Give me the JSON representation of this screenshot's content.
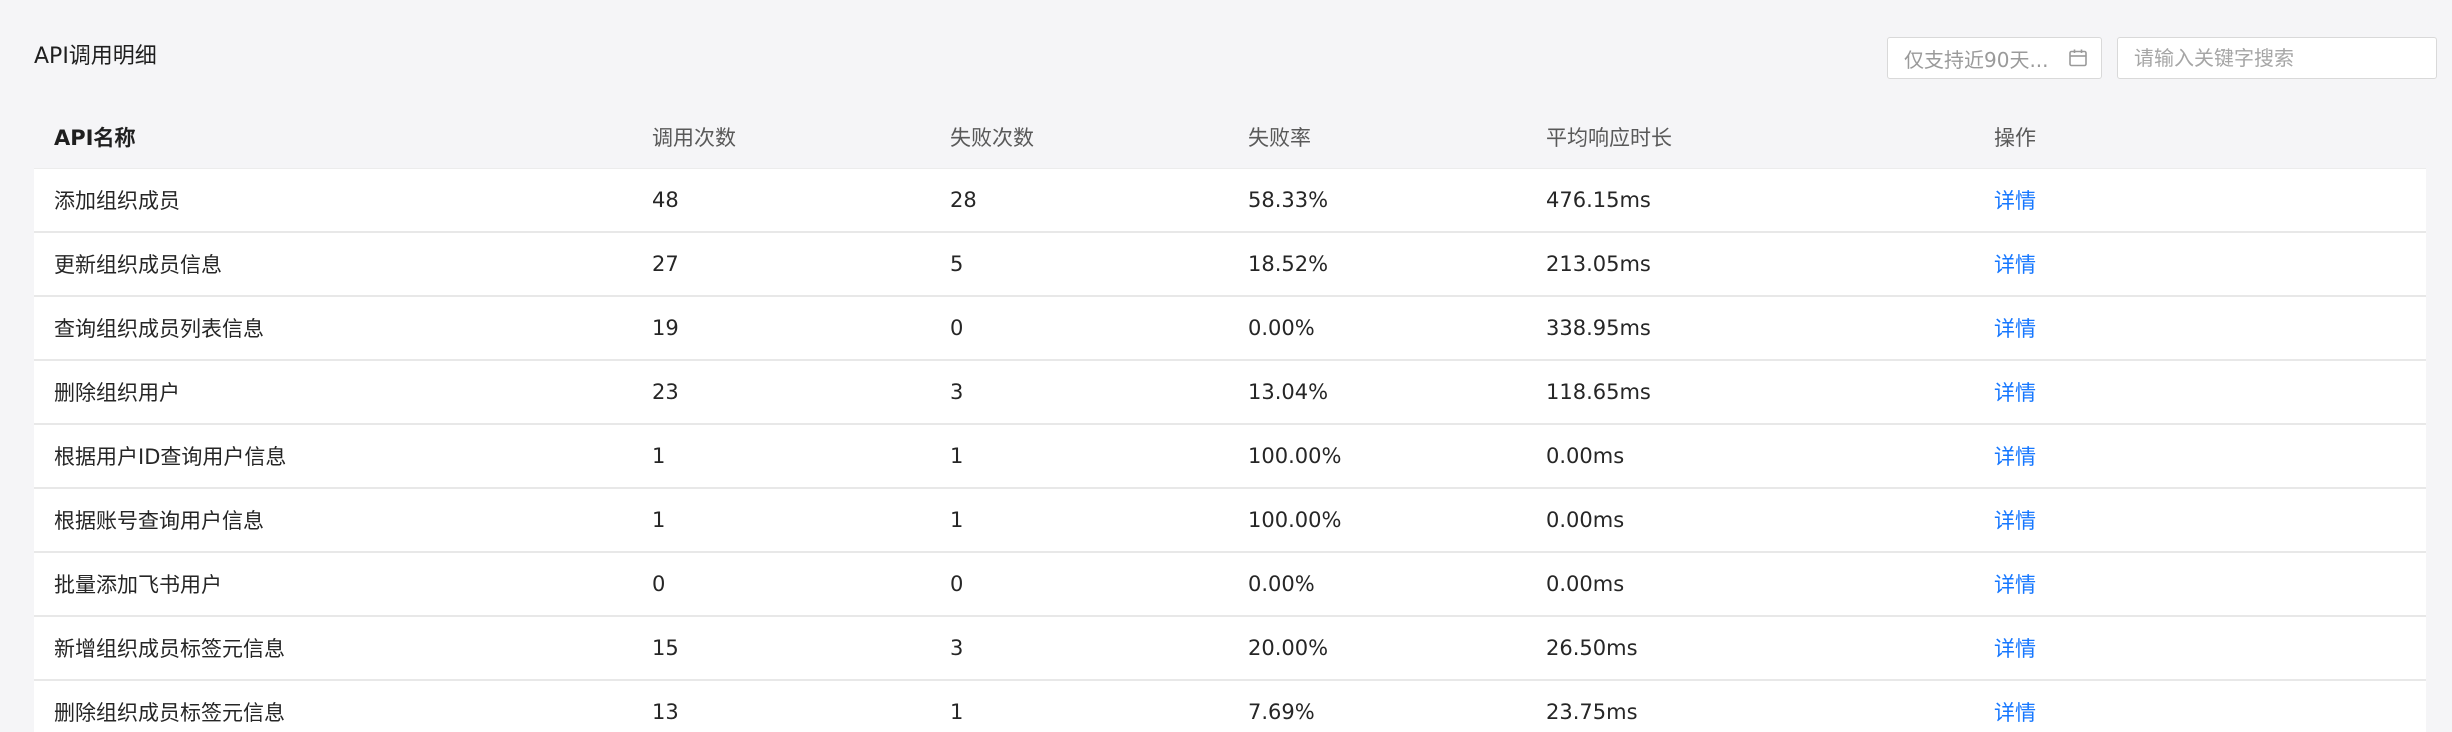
{
  "header": {
    "title": "API调用明细",
    "date_filter_label": "仅支持近90天...",
    "search_placeholder": "请输入关键字搜索"
  },
  "table": {
    "columns": [
      "API名称",
      "调用次数",
      "失败次数",
      "失败率",
      "平均响应时长",
      "操作"
    ],
    "rows": [
      {
        "name": "添加组织成员",
        "calls": "48",
        "failures": "28",
        "failure_rate": "58.33%",
        "avg_time": "476.15ms",
        "action": "详情"
      },
      {
        "name": "更新组织成员信息",
        "calls": "27",
        "failures": "5",
        "failure_rate": "18.52%",
        "avg_time": "213.05ms",
        "action": "详情"
      },
      {
        "name": "查询组织成员列表信息",
        "calls": "19",
        "failures": "0",
        "failure_rate": "0.00%",
        "avg_time": "338.95ms",
        "action": "详情"
      },
      {
        "name": "删除组织用户",
        "calls": "23",
        "failures": "3",
        "failure_rate": "13.04%",
        "avg_time": "118.65ms",
        "action": "详情"
      },
      {
        "name": "根据用户ID查询用户信息",
        "calls": "1",
        "failures": "1",
        "failure_rate": "100.00%",
        "avg_time": "0.00ms",
        "action": "详情"
      },
      {
        "name": "根据账号查询用户信息",
        "calls": "1",
        "failures": "1",
        "failure_rate": "100.00%",
        "avg_time": "0.00ms",
        "action": "详情"
      },
      {
        "name": "批量添加飞书用户",
        "calls": "0",
        "failures": "0",
        "failure_rate": "0.00%",
        "avg_time": "0.00ms",
        "action": "详情"
      },
      {
        "name": "新增组织成员标签元信息",
        "calls": "15",
        "failures": "3",
        "failure_rate": "20.00%",
        "avg_time": "26.50ms",
        "action": "详情"
      },
      {
        "name": "删除组织成员标签元信息",
        "calls": "13",
        "failures": "1",
        "failure_rate": "7.69%",
        "avg_time": "23.75ms",
        "action": "详情"
      }
    ]
  },
  "icons": {
    "date_filter": "calendar-icon"
  },
  "colors": {
    "link": "#1677ff",
    "background": "#f5f5f7"
  }
}
